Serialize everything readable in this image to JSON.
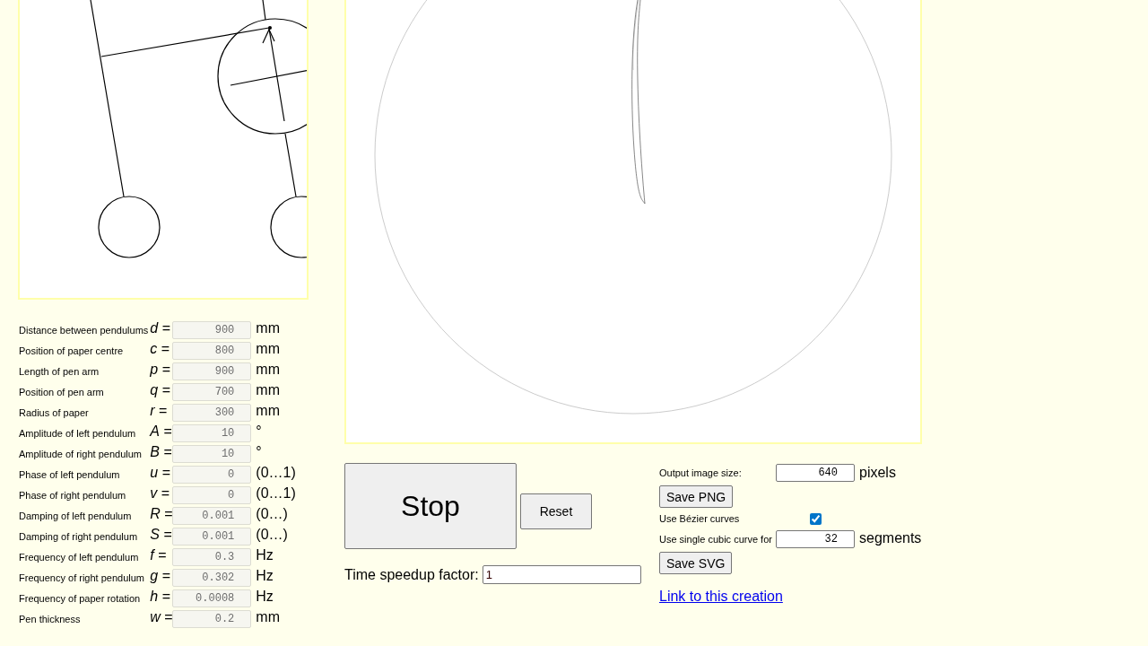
{
  "parameters": [
    {
      "label": "Distance between pendulums",
      "symbol": "*d* =",
      "value": "900",
      "unit": "mm",
      "disabled": true
    },
    {
      "label": "Position of paper centre",
      "symbol": "*c* =",
      "value": "800",
      "unit": "mm",
      "disabled": true
    },
    {
      "label": "Length of pen arm",
      "symbol": "*p* =",
      "value": "900",
      "unit": "mm",
      "disabled": true
    },
    {
      "label": "Position of pen arm",
      "symbol": "*q* =",
      "value": "700",
      "unit": "mm",
      "disabled": true
    },
    {
      "label": "Radius of paper",
      "symbol": "*r* =",
      "value": "300",
      "unit": "mm",
      "disabled": true
    },
    {
      "label": "Amplitude of left pendulum",
      "symbol": "*A* =",
      "value": "10",
      "unit": "°",
      "disabled": true
    },
    {
      "label": "Amplitude of right pendulum",
      "symbol": "*B* =",
      "value": "10",
      "unit": "°",
      "disabled": true
    },
    {
      "label": "Phase of left pendulum",
      "symbol": "*u* =",
      "value": "0",
      "unit": "(0…1)",
      "disabled": true
    },
    {
      "label": "Phase of right pendulum",
      "symbol": "*v* =",
      "value": "0",
      "unit": "(0…1)",
      "disabled": true
    },
    {
      "label": "Damping of left pendulum",
      "symbol": "*R* =",
      "value": "0.001",
      "unit": "(0…)",
      "disabled": true
    },
    {
      "label": "Damping of right pendulum",
      "symbol": "*S* =",
      "value": "0.001",
      "unit": "(0…)",
      "disabled": true
    },
    {
      "label": "Frequency of left pendulum",
      "symbol": "*f* =",
      "value": "0.3",
      "unit": "Hz",
      "disabled": true
    },
    {
      "label": "Frequency of right pendulum",
      "symbol": "*g* =",
      "value": "0.302",
      "unit": "Hz",
      "disabled": true
    },
    {
      "label": "Frequency of paper rotation",
      "symbol": "*h* =",
      "value": "0.0008",
      "unit": "Hz",
      "disabled": true
    },
    {
      "label": "Pen thickness",
      "symbol": "*w* =",
      "value": "0.2",
      "unit": "mm",
      "disabled": true
    }
  ],
  "controls": {
    "stop_button": "Stop",
    "reset_button": "Reset",
    "speedup": {
      "label": "Time speedup factor:",
      "value": "1"
    }
  },
  "export": {
    "size": {
      "label": "Output image size:",
      "value": "640",
      "unit": "pixels"
    },
    "save_png": "Save PNG",
    "bezier": {
      "label": "Use Bézier curves",
      "checked": true
    },
    "segments": {
      "label": "Use single cubic curve for",
      "value": "32",
      "unit": "segments"
    },
    "save_svg": "Save SVG"
  },
  "link": "Link to this creation"
}
